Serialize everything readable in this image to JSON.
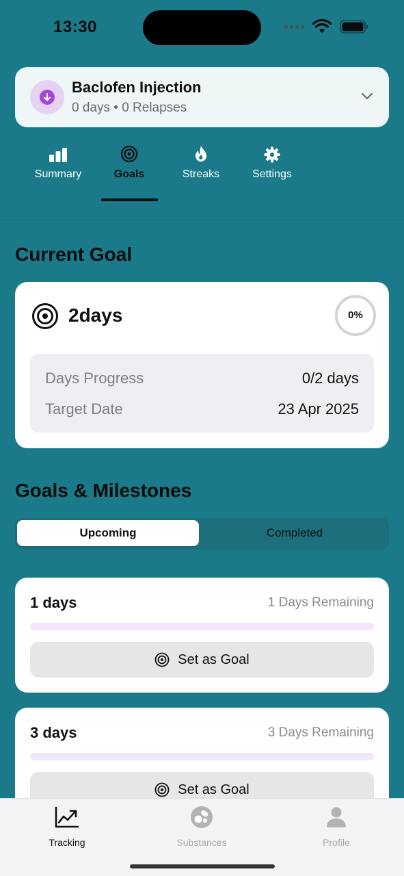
{
  "status_bar": {
    "time": "13:30"
  },
  "substance": {
    "name": "Baclofen Injection",
    "meta": "0 days • 0 Relapses",
    "avatar_icon": "arrow-down-circle-icon",
    "accent": "#a347d8"
  },
  "tabs": [
    {
      "label": "Summary",
      "icon": "bar-chart-icon",
      "active": false
    },
    {
      "label": "Goals",
      "icon": "target-icon",
      "active": true
    },
    {
      "label": "Streaks",
      "icon": "flame-icon",
      "active": false
    },
    {
      "label": "Settings",
      "icon": "gear-icon",
      "active": false
    }
  ],
  "current_goal": {
    "section_title": "Current Goal",
    "title": "2days",
    "progress_label": "0%",
    "progress_fraction": 0,
    "details": [
      {
        "label": "Days Progress",
        "value": "0/2 days"
      },
      {
        "label": "Target Date",
        "value": "23 Apr 2025"
      }
    ]
  },
  "milestones": {
    "section_title": "Goals & Milestones",
    "segments": {
      "upcoming": "Upcoming",
      "completed": "Completed",
      "selected": "Upcoming"
    },
    "items": [
      {
        "title": "1 days",
        "remaining": "1 Days Remaining",
        "progress_fraction": 0,
        "button": "Set as Goal"
      },
      {
        "title": "3 days",
        "remaining": "3 Days Remaining",
        "progress_fraction": 0,
        "button": "Set as Goal"
      }
    ]
  },
  "bottom_nav": [
    {
      "label": "Tracking",
      "icon": "trend-chart-icon",
      "active": true
    },
    {
      "label": "Substances",
      "icon": "pills-icon",
      "active": false
    },
    {
      "label": "Profile",
      "icon": "person-icon",
      "active": false
    }
  ],
  "colors": {
    "background": "#1a7a8a",
    "accent": "#a347d8",
    "progress_track": "#f3e6fb"
  }
}
